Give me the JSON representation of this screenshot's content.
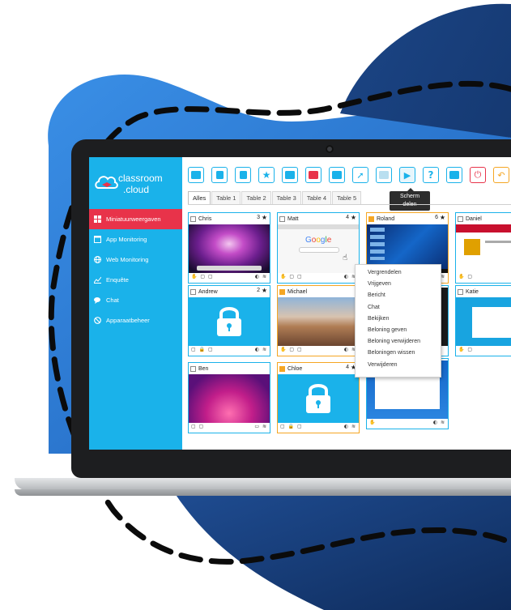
{
  "app": {
    "logo_line1": "classroom",
    "logo_line2": ".cloud"
  },
  "sidebar": {
    "items": [
      {
        "label": "Miniatuurweergaven",
        "icon": "grid-icon",
        "active": true
      },
      {
        "label": "App Monitoring",
        "icon": "app-window-icon",
        "active": false
      },
      {
        "label": "Web Monitoring",
        "icon": "globe-icon",
        "active": false
      },
      {
        "label": "Enquête",
        "icon": "chart-icon",
        "active": false
      },
      {
        "label": "Chat",
        "icon": "chat-icon",
        "active": false
      },
      {
        "label": "Apparaatbeheer",
        "icon": "block-icon",
        "active": false
      }
    ]
  },
  "toolbar": {
    "buttons": [
      {
        "icon": "contact-card-icon"
      },
      {
        "icon": "lock-icon"
      },
      {
        "icon": "unlock-icon"
      },
      {
        "icon": "star-icon"
      },
      {
        "icon": "mail-icon"
      },
      {
        "icon": "dots-icon"
      },
      {
        "icon": "monitor-icon"
      },
      {
        "icon": "rocket-icon"
      },
      {
        "icon": "eye-icon"
      },
      {
        "icon": "share-screen-icon"
      },
      {
        "icon": "help-icon"
      },
      {
        "icon": "teacher-screen-icon"
      },
      {
        "icon": "power-icon"
      },
      {
        "icon": "undo-icon"
      }
    ],
    "tooltip_line1": "Scherm",
    "tooltip_line2": "delen"
  },
  "tabs": [
    "Alles",
    "Table 1",
    "Table 2",
    "Table 3",
    "Table 4",
    "Table 5"
  ],
  "students": [
    {
      "name": "Chris",
      "count": "3",
      "checked": false,
      "screen": "mac-purple"
    },
    {
      "name": "Matt",
      "count": "4",
      "checked": false,
      "screen": "google"
    },
    {
      "name": "Roland",
      "count": "6",
      "checked": true,
      "screen": "windows"
    },
    {
      "name": "Daniel",
      "count": "",
      "checked": false,
      "screen": "web-red"
    },
    {
      "name": "Andrew",
      "count": "2",
      "checked": false,
      "screen": "locked"
    },
    {
      "name": "Michael",
      "count": "",
      "checked": true,
      "screen": "desert"
    },
    {
      "name": "Katie",
      "count": "",
      "checked": false,
      "screen": "web-blue"
    },
    {
      "name": "Ben",
      "count": "",
      "checked": false,
      "screen": "mac-pink"
    },
    {
      "name": "Chloe",
      "count": "4",
      "checked": true,
      "screen": "locked"
    }
  ],
  "context_menu": [
    "Vergrendelen",
    "Vrijgeven",
    "Bericht",
    "Chat",
    "Bekijken",
    "Beloning geven",
    "Beloning verwijderen",
    "Beloningen wissen",
    "Verwijderen"
  ],
  "colors": {
    "accent": "#1ab2ea",
    "active_nav": "#e8334a",
    "checkbox_on": "#f5a623",
    "blob_dark": "#17386e",
    "blob_light": "#2f7fd8"
  }
}
